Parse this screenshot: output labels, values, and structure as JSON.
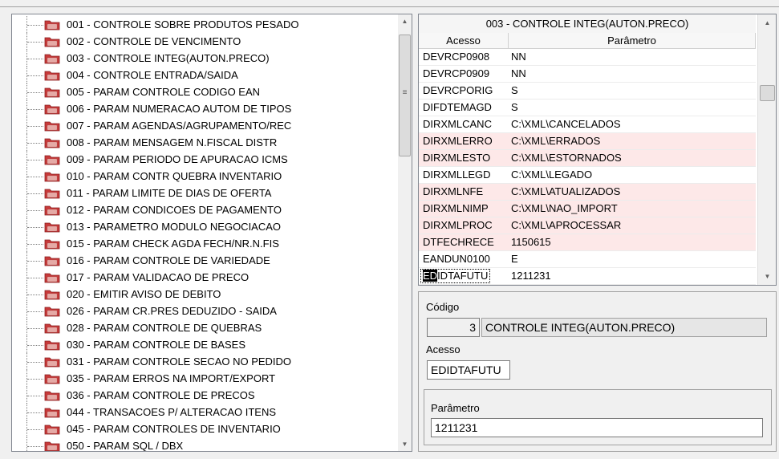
{
  "tree": {
    "items": [
      {
        "label": "001 - CONTROLE SOBRE PRODUTOS PESADO"
      },
      {
        "label": "002 - CONTROLE DE VENCIMENTO"
      },
      {
        "label": "003 - CONTROLE INTEG(AUTON.PRECO)"
      },
      {
        "label": "004 - CONTROLE ENTRADA/SAIDA"
      },
      {
        "label": "005 - PARAM CONTROLE CODIGO EAN"
      },
      {
        "label": "006 - PARAM NUMERACAO AUTOM DE TIPOS"
      },
      {
        "label": "007 - PARAM AGENDAS/AGRUPAMENTO/REC"
      },
      {
        "label": "008 - PARAM MENSAGEM N.FISCAL DISTR"
      },
      {
        "label": "009 - PARAM PERIODO DE APURACAO ICMS"
      },
      {
        "label": "010 - PARAM CONTR QUEBRA INVENTARIO"
      },
      {
        "label": "011 - PARAM LIMITE DE DIAS DE OFERTA"
      },
      {
        "label": "012 - PARAM CONDICOES DE PAGAMENTO"
      },
      {
        "label": "013 - PARAMETRO MODULO NEGOCIACAO"
      },
      {
        "label": "015 - PARAM CHECK AGDA FECH/NR.N.FIS"
      },
      {
        "label": "016 - PARAM CONTROLE DE VARIEDADE"
      },
      {
        "label": "017 - PARAM VALIDACAO DE PRECO"
      },
      {
        "label": "020 - EMITIR AVISO DE DEBITO"
      },
      {
        "label": "026 - PARAM CR.PRES DEDUZIDO - SAIDA"
      },
      {
        "label": "028 - PARAM CONTROLE DE QUEBRAS"
      },
      {
        "label": "030 - PARAM CONTROLE DE BASES"
      },
      {
        "label": "031 - PARAM CONTROLE SECAO NO PEDIDO"
      },
      {
        "label": "035 - PARAM ERROS NA IMPORT/EXPORT"
      },
      {
        "label": "036 - PARAM CONTROLE DE PRECOS"
      },
      {
        "label": "044 - TRANSACOES P/ ALTERACAO ITENS"
      },
      {
        "label": "045 - PARAM CONTROLES DE INVENTARIO"
      },
      {
        "label": "050 - PARAM SQL / DBX"
      }
    ]
  },
  "grid": {
    "title": "003 - CONTROLE INTEG(AUTON.PRECO)",
    "col_acesso": "Acesso",
    "col_parametro": "Parâmetro",
    "rows": [
      {
        "acesso": "DEVRCP0908",
        "parametro": "NN"
      },
      {
        "acesso": "DEVRCP0909",
        "parametro": "NN"
      },
      {
        "acesso": "DEVRCPORIG",
        "parametro": "S"
      },
      {
        "acesso": "DIFDTEMAGD",
        "parametro": "S"
      },
      {
        "acesso": "DIRXMLCANC",
        "parametro": "C:\\XML\\CANCELADOS"
      },
      {
        "acesso": "DIRXMLERRO",
        "parametro": "C:\\XML\\ERRADOS"
      },
      {
        "acesso": "DIRXMLESTO",
        "parametro": "C:\\XML\\ESTORNADOS"
      },
      {
        "acesso": "DIRXMLLEGD",
        "parametro": "C:\\XML\\LEGADO"
      },
      {
        "acesso": "DIRXMLNFE",
        "parametro": "C:\\XML\\ATUALIZADOS"
      },
      {
        "acesso": "DIRXMLNIMP",
        "parametro": "C:\\XML\\NAO_IMPORT"
      },
      {
        "acesso": "DIRXMLPROC",
        "parametro": "C:\\XML\\APROCESSAR"
      },
      {
        "acesso": "DTFECHRECE",
        "parametro": "1150615"
      },
      {
        "acesso": "EANDUN0100",
        "parametro": "E"
      }
    ],
    "edit_row": {
      "selected": "ED",
      "rest": "IDTAFUTU",
      "parametro": "1211231"
    }
  },
  "detail": {
    "codigo_label": "Código",
    "codigo_value": "3",
    "codigo_desc": "CONTROLE INTEG(AUTON.PRECO)",
    "acesso_label": "Acesso",
    "acesso_value": "EDIDTAFUTU",
    "parametro_label": "Parâmetro",
    "parametro_value": "1211231"
  },
  "colors": {
    "highlight_row": "#fde8e8",
    "folder_red": "#c83a3a",
    "folder_pink": "#f7c9c3"
  }
}
